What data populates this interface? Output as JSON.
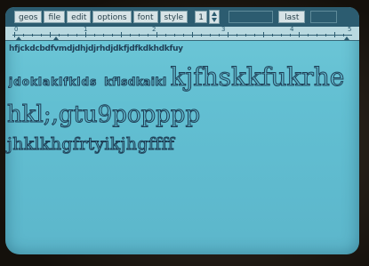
{
  "menu": {
    "items": [
      "geos",
      "file",
      "edit",
      "options",
      "font",
      "style"
    ],
    "point_size": "1",
    "last_label": "last"
  },
  "ruler": {
    "labels": [
      "0",
      "1",
      "2",
      "3",
      "4",
      "5"
    ]
  },
  "document": {
    "line1": "hfjckdcbdfvmdjdhjdjrhdjdkfjdfkdkhdkfuy",
    "line2_a": "jdoklaklfklds",
    "line2_b": "kflsdkaikl",
    "line2_c": "kjfhskkfukrhe",
    "line3": "hkl;,gtu9popppp",
    "line4": "jhklkhgfrtyikjhgffff"
  },
  "colors": {
    "screen": "#62bfd2",
    "menubar": "#2c5c70",
    "text_outline": "#1f3f56"
  }
}
